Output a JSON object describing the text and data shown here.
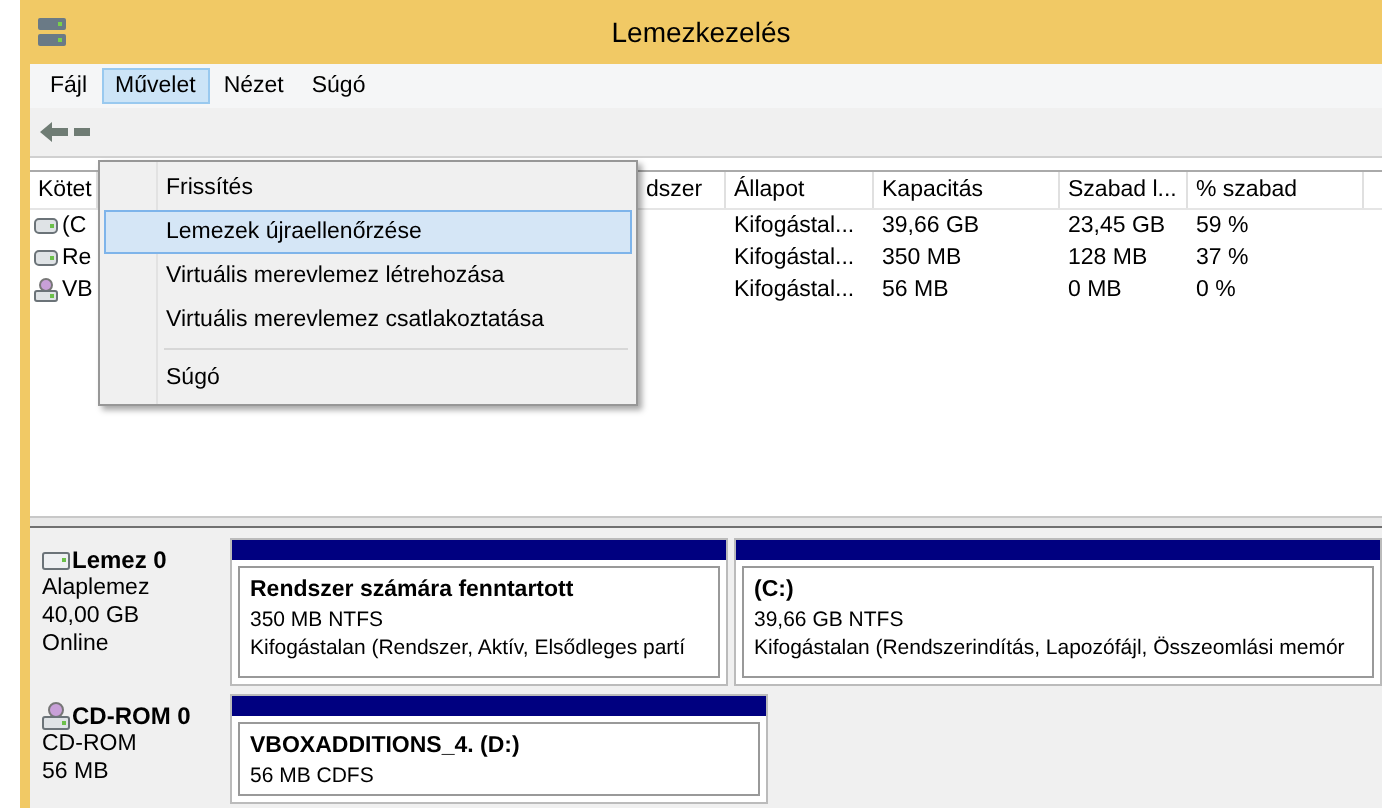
{
  "window": {
    "title": "Lemezkezelés"
  },
  "menu_bar": [
    {
      "label": "Fájl",
      "selected": false
    },
    {
      "label": "Művelet",
      "selected": true
    },
    {
      "label": "Nézet",
      "selected": false
    },
    {
      "label": "Súgó",
      "selected": false
    }
  ],
  "open_menu": [
    {
      "label": "Frissítés",
      "selected": false,
      "separator_before": false
    },
    {
      "label": "Lemezek újraellenőrzése",
      "selected": true,
      "separator_before": false
    },
    {
      "label": "Virtuális merevlemez létrehozása",
      "selected": false,
      "separator_before": false
    },
    {
      "label": "Virtuális merevlemez csatlakoztatása",
      "selected": false,
      "separator_before": false
    },
    {
      "label": "Súgó",
      "selected": false,
      "separator_before": true
    }
  ],
  "volume_table": {
    "columns": [
      "Kötet",
      "dszer",
      "Állapot",
      "Kapacitás",
      "Szabad l...",
      "% szabad"
    ],
    "rows": [
      {
        "kind": "disk",
        "volume": "(C",
        "status": "Kifogástal...",
        "capacity": "39,66 GB",
        "free": "23,45 GB",
        "free_pct": "59 %"
      },
      {
        "kind": "disk",
        "volume": "Re",
        "status": "Kifogástal...",
        "capacity": "350 MB",
        "free": "128 MB",
        "free_pct": "37 %"
      },
      {
        "kind": "cdrom",
        "volume": "VB",
        "status": "Kifogástal...",
        "capacity": "56 MB",
        "free": "0 MB",
        "free_pct": "0 %"
      }
    ]
  },
  "disks": [
    {
      "kind": "disk",
      "name": "Lemez 0",
      "lines": [
        "Alaplemez",
        "40,00 GB",
        "Online"
      ],
      "partitions": [
        {
          "name": "Rendszer számára fenntartott",
          "size": "350 MB NTFS",
          "status": "Kifogástalan (Rendszer, Aktív, Elsődleges partí"
        },
        {
          "name": "(C:)",
          "size": "39,66 GB NTFS",
          "status": "Kifogástalan (Rendszerindítás, Lapozófájl, Összeomlási memór"
        }
      ]
    },
    {
      "kind": "cdrom",
      "name": "CD-ROM 0",
      "lines": [
        "CD-ROM",
        "56 MB"
      ],
      "partitions": [
        {
          "name": "VBOXADDITIONS_4.  (D:)",
          "size": "56 MB CDFS"
        }
      ]
    }
  ]
}
